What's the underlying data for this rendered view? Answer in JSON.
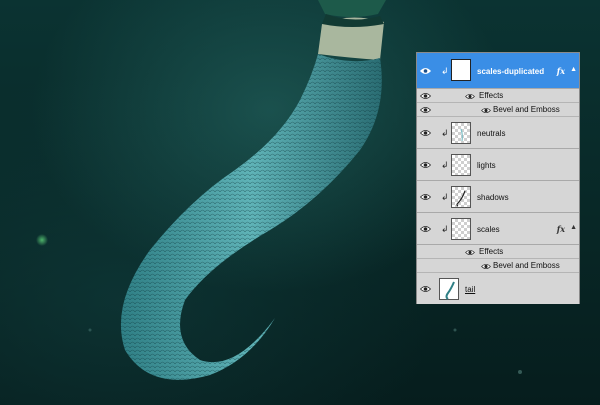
{
  "layers": [
    {
      "name": "scales-duplicated",
      "selected": true,
      "fx": "fx",
      "effects_label": "Effects",
      "effect": "Bevel and Emboss"
    },
    {
      "name": "neutrals"
    },
    {
      "name": "lights"
    },
    {
      "name": "shadows"
    },
    {
      "name": "scales",
      "fx": "fx",
      "effects_label": "Effects",
      "effect": "Bevel and Emboss"
    },
    {
      "name": "tail"
    }
  ],
  "icons": {
    "eye": "eye-icon",
    "clip": "clipping-arrow-icon",
    "fx": "layer-style-icon",
    "scroll": "scroll-up-icon"
  },
  "colors": {
    "selection": "#3a8ee6",
    "panel": "#d6d6d6",
    "water_dark": "#061d1d",
    "tail": "#3c8f93"
  }
}
